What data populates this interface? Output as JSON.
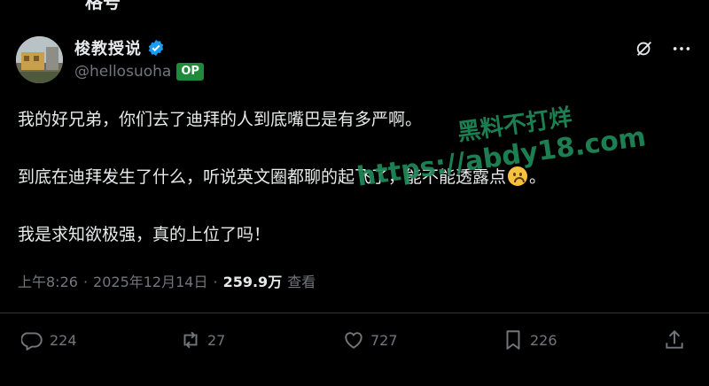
{
  "top_fragment": "格号",
  "author": {
    "display_name": "梭教授说",
    "handle": "@hellosuoha",
    "badge": "OP"
  },
  "post": {
    "paragraphs": [
      "我的好兄弟，你们去了迪拜的人到底嘴巴是有多严啊。",
      "到底在迪拜发生了什么，听说英文圈都聊的起飞了，能不能透露点",
      "我是求知欲极强，真的上位了吗！"
    ],
    "paragraph2_suffix": "。"
  },
  "watermark": {
    "line1": "黑料不打烊",
    "line2": "https://abdy18.com"
  },
  "meta": {
    "time": "上午8:26",
    "date": "2025年12月14日",
    "views": "259.9万",
    "views_label": "查看",
    "sep": "·"
  },
  "actions": {
    "replies": "224",
    "reposts": "27",
    "likes": "727",
    "bookmarks": "226"
  },
  "colors": {
    "background": "#000000",
    "text": "#e7e9ea",
    "muted": "#71767b",
    "verified": "#1d9bf0",
    "op_badge": "#1f8a3a",
    "watermark": "#1f8a5a"
  }
}
